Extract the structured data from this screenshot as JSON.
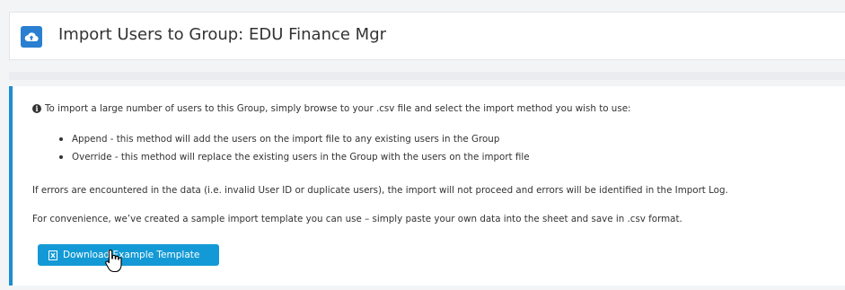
{
  "header": {
    "icon": "cloud-upload-icon",
    "title": "Import Users to Group: EDU Finance Mgr"
  },
  "info": {
    "icon": "info-circle-icon",
    "intro": "To import a large number of users to this Group, simply browse to your .csv file and select the import method you wish to use:",
    "bullets": [
      "Append - this method will add the users on the import file to any existing users in the Group",
      "Override - this method will replace the existing users in the Group with the users on the import file"
    ],
    "errors_note": "If errors are encountered in the data (i.e. invalid User ID or duplicate users), the import will not proceed and errors will be identified in the Import Log.",
    "template_note": "For convenience, we’ve created a sample import template you can use – simply paste your own data into the sheet and save in .csv format."
  },
  "download_button": {
    "icon": "file-excel-icon",
    "label": "Download Example Template"
  },
  "colors": {
    "accent": "#1c8ecf",
    "button": "#139ad6",
    "header_icon_bg": "#2a7fd0"
  }
}
